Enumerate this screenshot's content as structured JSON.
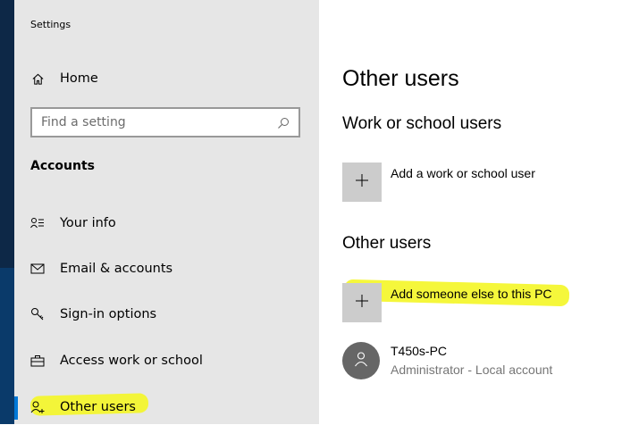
{
  "window": {
    "title": "Settings"
  },
  "sidebar": {
    "home_label": "Home",
    "search_placeholder": "Find a setting",
    "section_heading": "Accounts",
    "items": [
      {
        "label": "Your info",
        "icon": "person-lines-icon"
      },
      {
        "label": "Email & accounts",
        "icon": "envelope-icon"
      },
      {
        "label": "Sign-in options",
        "icon": "key-icon"
      },
      {
        "label": "Access work or school",
        "icon": "briefcase-icon"
      },
      {
        "label": "Other users",
        "icon": "person-add-icon",
        "selected": true
      }
    ]
  },
  "main": {
    "page_title": "Other users",
    "work_section": {
      "heading": "Work or school users",
      "add_label": "Add a work or school user"
    },
    "other_section": {
      "heading": "Other users",
      "add_label": "Add someone else to this PC"
    },
    "users": [
      {
        "name": "T450s-PC",
        "role": "Administrator - Local account"
      }
    ]
  },
  "colors": {
    "sidebar_bg": "#e6e6e6",
    "accent": "#0078d7",
    "highlighter": "#f4f62a",
    "tile_bg": "#cccccc",
    "avatar_bg": "#666666",
    "secondary_text": "#767676"
  }
}
